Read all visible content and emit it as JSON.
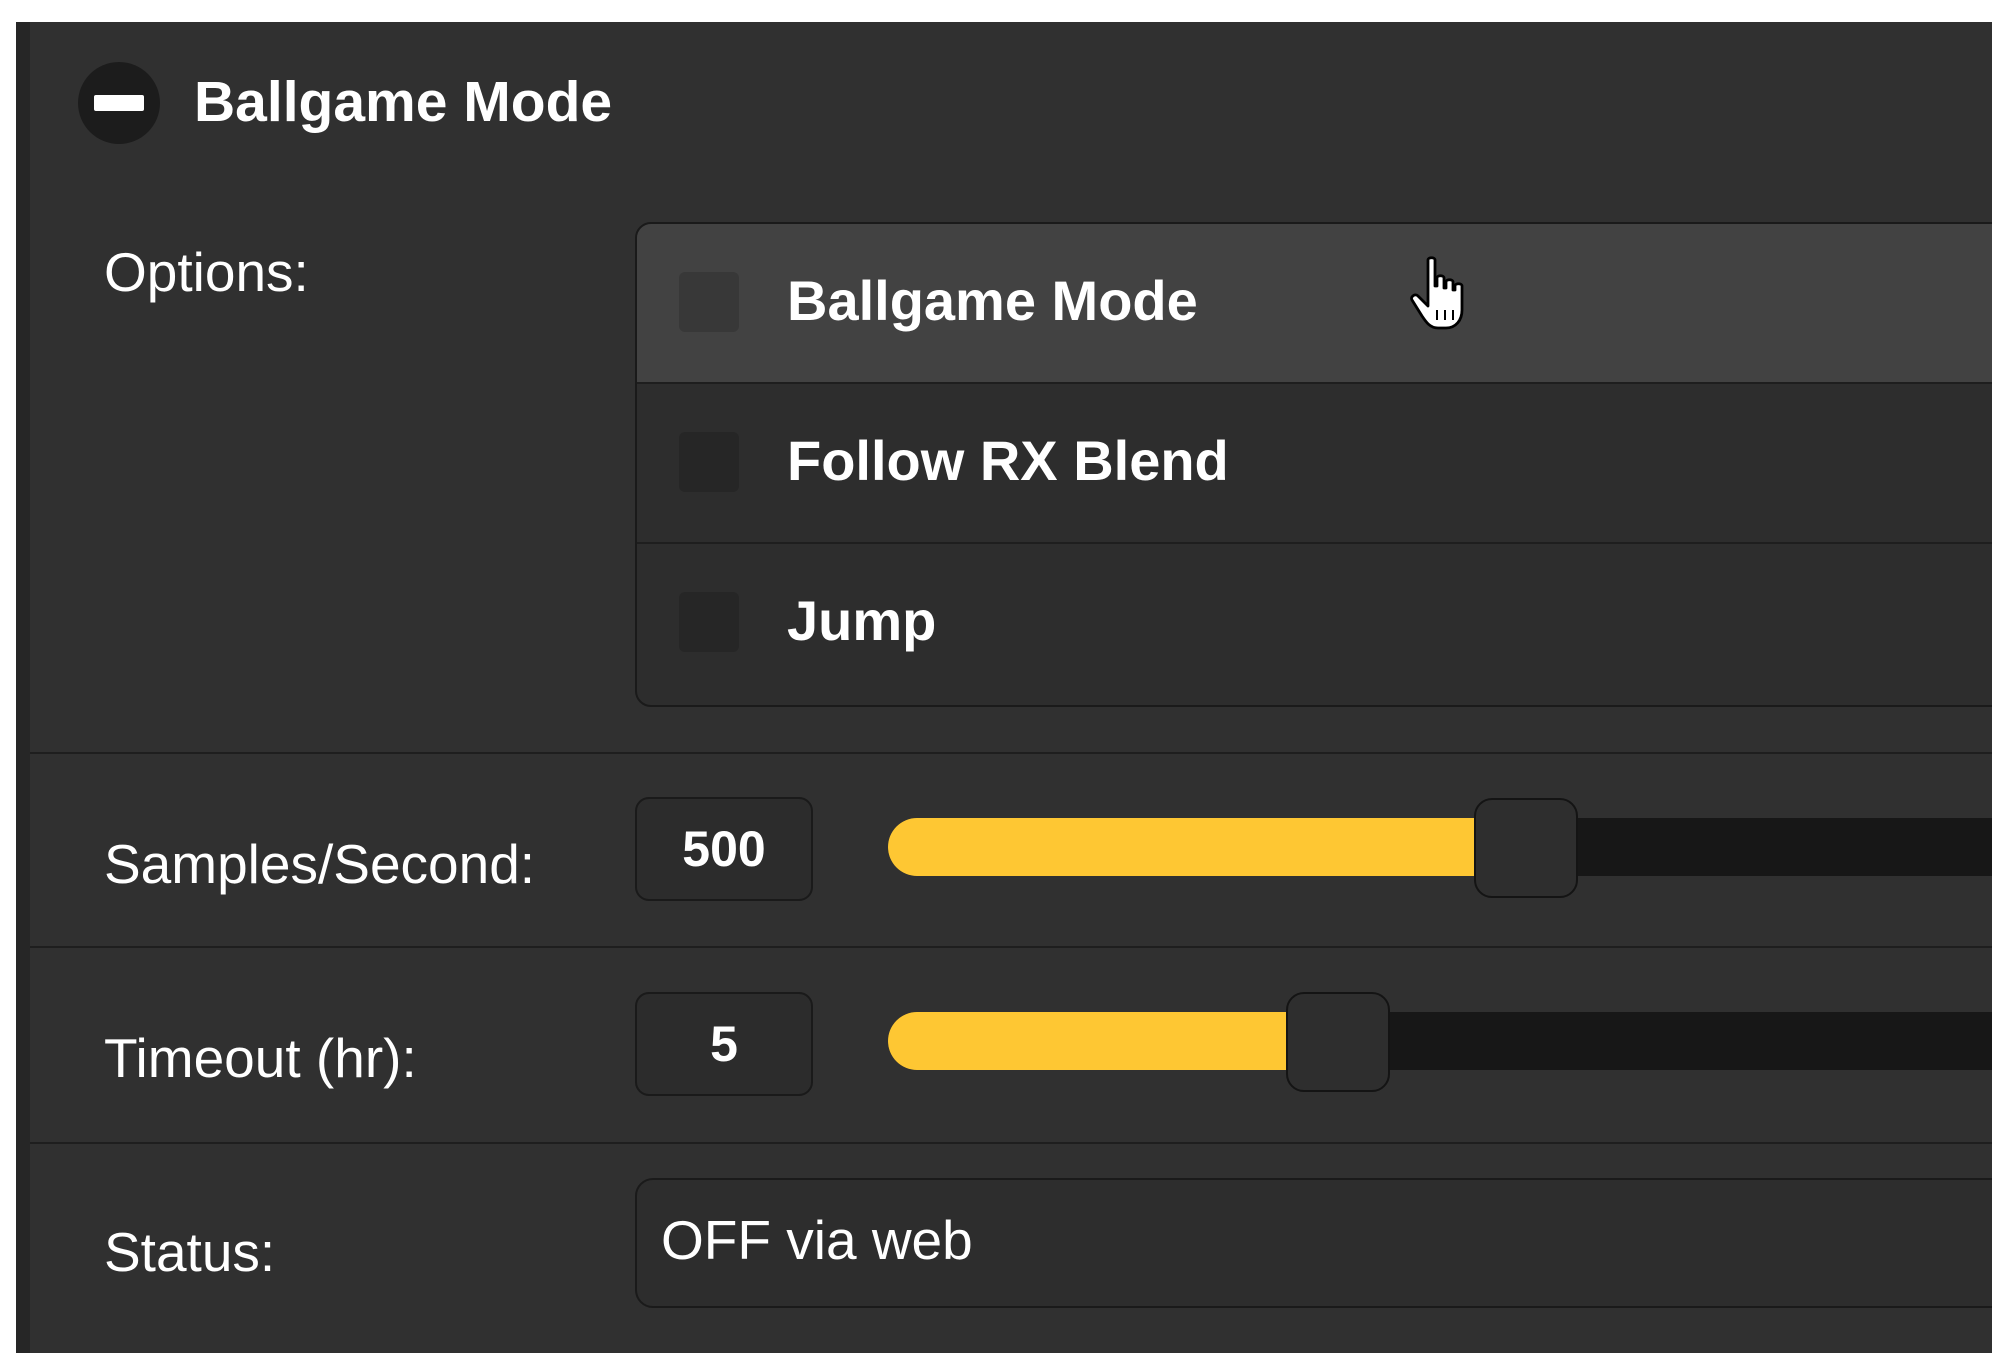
{
  "panel": {
    "title": "Ballgame Mode",
    "collapse_icon": "minus-icon"
  },
  "options": {
    "label": "Options:",
    "items": [
      {
        "label": "Ballgame Mode",
        "checked": false
      },
      {
        "label": "Follow RX Blend",
        "checked": false
      },
      {
        "label": "Jump",
        "checked": false
      }
    ]
  },
  "samples": {
    "label": "Samples/Second:",
    "value": "500",
    "slider_fraction": 0.56
  },
  "timeout": {
    "label": "Timeout (hr):",
    "value": "5",
    "slider_fraction": 0.395
  },
  "status": {
    "label": "Status:",
    "value": "OFF via web"
  },
  "colors": {
    "accent": "#fec733",
    "background": "#303030",
    "text": "#ffffff"
  },
  "cursor_icon": "hand-pointer-icon"
}
